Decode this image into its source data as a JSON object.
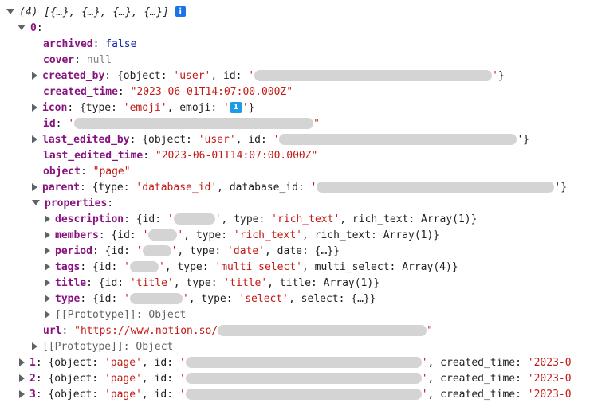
{
  "header": {
    "summary": "(4) [{…}, {…}, {…}, {…}]",
    "info_icon": "i"
  },
  "item0": {
    "index": "0",
    "archived": {
      "key": "archived",
      "value": "false"
    },
    "cover": {
      "key": "cover",
      "value": "null"
    },
    "created_by": {
      "key": "created_by",
      "prefix": "{object: ",
      "object_val": "'user'",
      "mid": ", id: ",
      "q1": "'",
      "q2": "'",
      "suffix": "}"
    },
    "created_time": {
      "key": "created_time",
      "value": "\"2023-06-01T14:07:00.000Z\""
    },
    "icon": {
      "key": "icon",
      "prefix": "{type: ",
      "type_val": "'emoji'",
      "mid": ", emoji: ",
      "q1": "'",
      "emoji": "1",
      "q2": "'",
      "suffix": "}"
    },
    "id": {
      "key": "id",
      "q1": "'",
      "q2": "\""
    },
    "last_edited_by": {
      "key": "last_edited_by",
      "prefix": "{object: ",
      "object_val": "'user'",
      "mid": ", id: ",
      "q1": "'",
      "suffix": "'}"
    },
    "last_edited_time": {
      "key": "last_edited_time",
      "value": "\"2023-06-01T14:07:00.000Z\""
    },
    "object": {
      "key": "object",
      "value": "\"page\""
    },
    "parent": {
      "key": "parent",
      "prefix": "{type: ",
      "type_val": "'database_id'",
      "mid": ", database_id: ",
      "q1": "'",
      "suffix": "'}"
    },
    "properties": {
      "key": "properties",
      "description": {
        "key": "description",
        "p1": "{id: ",
        "q1": "'",
        "q2": "'",
        "p2": ", type: ",
        "type_val": "'rich_text'",
        "p3": ", rich_text: Array(1)}"
      },
      "members": {
        "key": "members",
        "p1": "{id: ",
        "q1": "'",
        "q2": "'",
        "p2": ", type: ",
        "type_val": "'rich_text'",
        "p3": ", rich_text: Array(1)}"
      },
      "period": {
        "key": "period",
        "p1": "{id: ",
        "q1": "'",
        "q2": "'",
        "p2": ", type: ",
        "type_val": "'date'",
        "p3": ", date: {…}}"
      },
      "tags": {
        "key": "tags",
        "p1": "{id: ",
        "q1": "'",
        "q2": "'",
        "p2": ", type: ",
        "type_val": "'multi_select'",
        "p3": ", multi_select: Array(4)}"
      },
      "title": {
        "key": "title",
        "p1": "{id: ",
        "id_val": "'title'",
        "p2": ", type: ",
        "type_val": "'title'",
        "p3": ", title: Array(1)}"
      },
      "type": {
        "key": "type",
        "p1": "{id: ",
        "q1": "'",
        "q2": "'",
        "p2": ", type: ",
        "type_val": "'select'",
        "p3": ", select: {…}}"
      },
      "prototype": "[[Prototype]]: Object"
    },
    "url": {
      "key": "url",
      "value_start": "\"https://www.notion.so/",
      "value_end": "\""
    },
    "prototype": "[[Prototype]]: Object"
  },
  "items": [
    {
      "index": "1",
      "prefix": "{object: ",
      "object_val": "'page'",
      "mid": ", id: ",
      "q1": "'",
      "after": ", created_time: ",
      "time_val": "'2023-0"
    },
    {
      "index": "2",
      "prefix": "{object: ",
      "object_val": "'page'",
      "mid": ", id: ",
      "q1": "'",
      "after": ", created_time: ",
      "time_val": "'2023-0"
    },
    {
      "index": "3",
      "prefix": "{object: ",
      "object_val": "'page'",
      "mid": ", id: ",
      "q1": "'",
      "after": ", created_time: ",
      "time_val": "'2023-0"
    }
  ],
  "colors": {
    "key": "#881280",
    "string": "#c41a16",
    "keyword": "#0d22aa",
    "null": "#808080",
    "redaction": "#d4d4d4",
    "badge": "#1a73e8"
  }
}
